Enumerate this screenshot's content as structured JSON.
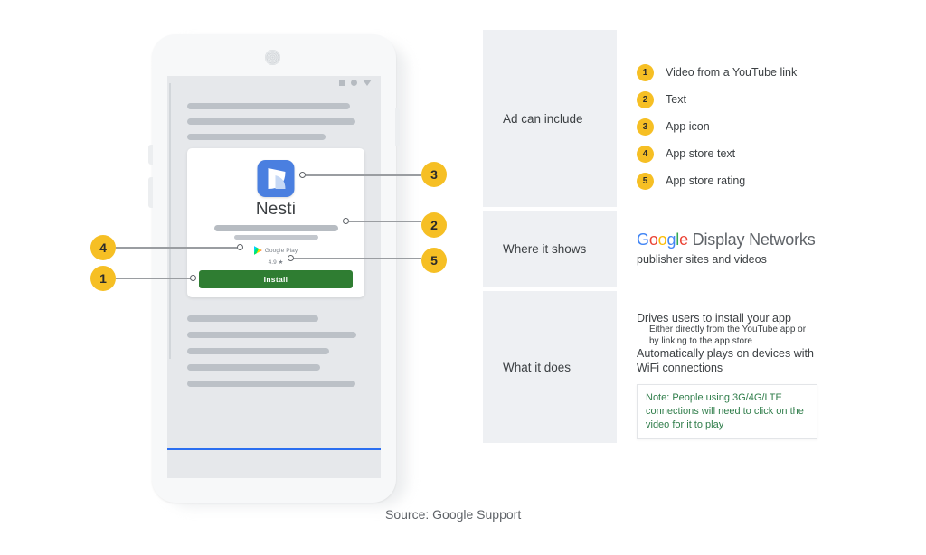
{
  "phone": {
    "status_icons": [
      "square-icon",
      "circle-icon",
      "triangle-icon"
    ],
    "ad_card": {
      "app_icon": "nesti-app-icon",
      "app_name": "Nesti",
      "store_icon": "google-play-icon",
      "store_label": "Google Play",
      "rating": "4.9 ★",
      "install_label": "Install"
    }
  },
  "callouts": [
    {
      "number": "1",
      "target": "install-button"
    },
    {
      "number": "2",
      "target": "ad-text"
    },
    {
      "number": "3",
      "target": "app-icon"
    },
    {
      "number": "4",
      "target": "app-store-text"
    },
    {
      "number": "5",
      "target": "app-store-rating"
    }
  ],
  "table": {
    "rows": [
      {
        "label": "Ad can include"
      },
      {
        "label": "Where it shows"
      },
      {
        "label": "What it does"
      }
    ],
    "ad_can_include": [
      {
        "num": "1",
        "text": "Video from a YouTube link"
      },
      {
        "num": "2",
        "text": "Text"
      },
      {
        "num": "3",
        "text": "App icon"
      },
      {
        "num": "4",
        "text": "App store text"
      },
      {
        "num": "5",
        "text": "App store rating"
      }
    ],
    "where_it_shows": {
      "brand_letters": [
        "G",
        "o",
        "o",
        "g",
        "l",
        "e"
      ],
      "brand_suffix": " Display Networks",
      "subtitle": "publisher sites and videos"
    },
    "what_it_does": {
      "line1": "Drives users to install your app",
      "sub1": "Either directly from the YouTube app or",
      "sub2": "by linking to the app store",
      "line2": "Automatically plays on devices with",
      "line3": "WiFi connections",
      "note": "Note: People using 3G/4G/LTE connections will need to click on the video for it to play"
    }
  },
  "footer": {
    "source": "Source: Google Support"
  },
  "colors": {
    "badge": "#f6bf24",
    "install_green": "#2f7d32",
    "note_green": "#2f7d4a",
    "nav_blue": "#2b6ef0",
    "panel_gray": "#eef0f3"
  }
}
